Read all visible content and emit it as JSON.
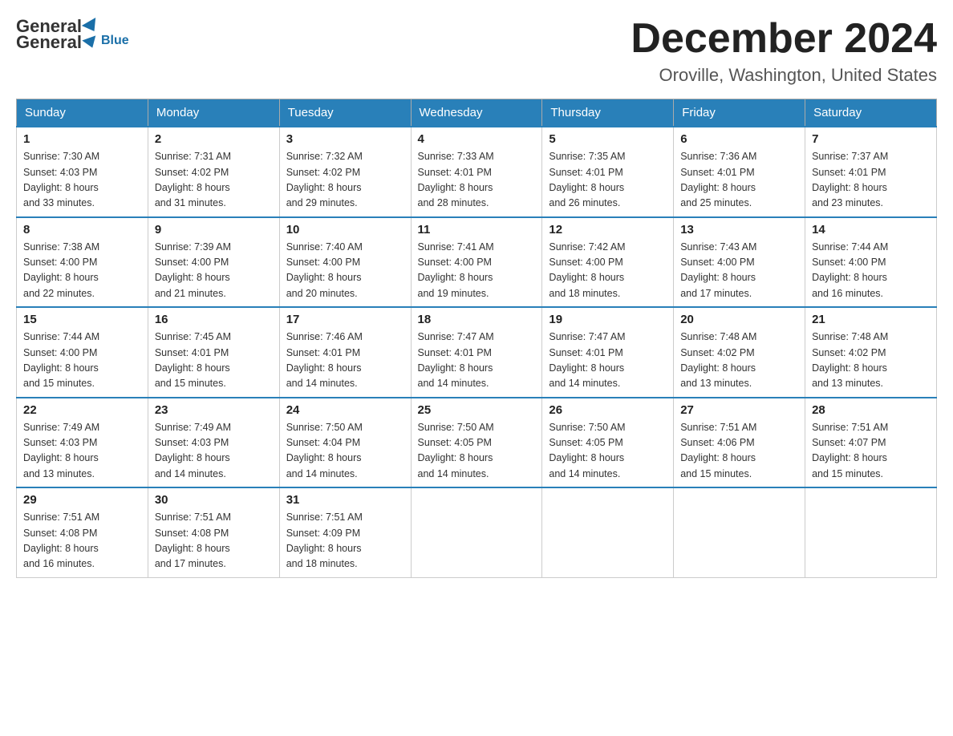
{
  "header": {
    "logo_general": "General",
    "logo_blue": "Blue",
    "month_title": "December 2024",
    "location": "Oroville, Washington, United States"
  },
  "weekdays": [
    "Sunday",
    "Monday",
    "Tuesday",
    "Wednesday",
    "Thursday",
    "Friday",
    "Saturday"
  ],
  "weeks": [
    [
      {
        "day": "1",
        "sunrise": "7:30 AM",
        "sunset": "4:03 PM",
        "daylight": "8 hours and 33 minutes."
      },
      {
        "day": "2",
        "sunrise": "7:31 AM",
        "sunset": "4:02 PM",
        "daylight": "8 hours and 31 minutes."
      },
      {
        "day": "3",
        "sunrise": "7:32 AM",
        "sunset": "4:02 PM",
        "daylight": "8 hours and 29 minutes."
      },
      {
        "day": "4",
        "sunrise": "7:33 AM",
        "sunset": "4:01 PM",
        "daylight": "8 hours and 28 minutes."
      },
      {
        "day": "5",
        "sunrise": "7:35 AM",
        "sunset": "4:01 PM",
        "daylight": "8 hours and 26 minutes."
      },
      {
        "day": "6",
        "sunrise": "7:36 AM",
        "sunset": "4:01 PM",
        "daylight": "8 hours and 25 minutes."
      },
      {
        "day": "7",
        "sunrise": "7:37 AM",
        "sunset": "4:01 PM",
        "daylight": "8 hours and 23 minutes."
      }
    ],
    [
      {
        "day": "8",
        "sunrise": "7:38 AM",
        "sunset": "4:00 PM",
        "daylight": "8 hours and 22 minutes."
      },
      {
        "day": "9",
        "sunrise": "7:39 AM",
        "sunset": "4:00 PM",
        "daylight": "8 hours and 21 minutes."
      },
      {
        "day": "10",
        "sunrise": "7:40 AM",
        "sunset": "4:00 PM",
        "daylight": "8 hours and 20 minutes."
      },
      {
        "day": "11",
        "sunrise": "7:41 AM",
        "sunset": "4:00 PM",
        "daylight": "8 hours and 19 minutes."
      },
      {
        "day": "12",
        "sunrise": "7:42 AM",
        "sunset": "4:00 PM",
        "daylight": "8 hours and 18 minutes."
      },
      {
        "day": "13",
        "sunrise": "7:43 AM",
        "sunset": "4:00 PM",
        "daylight": "8 hours and 17 minutes."
      },
      {
        "day": "14",
        "sunrise": "7:44 AM",
        "sunset": "4:00 PM",
        "daylight": "8 hours and 16 minutes."
      }
    ],
    [
      {
        "day": "15",
        "sunrise": "7:44 AM",
        "sunset": "4:00 PM",
        "daylight": "8 hours and 15 minutes."
      },
      {
        "day": "16",
        "sunrise": "7:45 AM",
        "sunset": "4:01 PM",
        "daylight": "8 hours and 15 minutes."
      },
      {
        "day": "17",
        "sunrise": "7:46 AM",
        "sunset": "4:01 PM",
        "daylight": "8 hours and 14 minutes."
      },
      {
        "day": "18",
        "sunrise": "7:47 AM",
        "sunset": "4:01 PM",
        "daylight": "8 hours and 14 minutes."
      },
      {
        "day": "19",
        "sunrise": "7:47 AM",
        "sunset": "4:01 PM",
        "daylight": "8 hours and 14 minutes."
      },
      {
        "day": "20",
        "sunrise": "7:48 AM",
        "sunset": "4:02 PM",
        "daylight": "8 hours and 13 minutes."
      },
      {
        "day": "21",
        "sunrise": "7:48 AM",
        "sunset": "4:02 PM",
        "daylight": "8 hours and 13 minutes."
      }
    ],
    [
      {
        "day": "22",
        "sunrise": "7:49 AM",
        "sunset": "4:03 PM",
        "daylight": "8 hours and 13 minutes."
      },
      {
        "day": "23",
        "sunrise": "7:49 AM",
        "sunset": "4:03 PM",
        "daylight": "8 hours and 14 minutes."
      },
      {
        "day": "24",
        "sunrise": "7:50 AM",
        "sunset": "4:04 PM",
        "daylight": "8 hours and 14 minutes."
      },
      {
        "day": "25",
        "sunrise": "7:50 AM",
        "sunset": "4:05 PM",
        "daylight": "8 hours and 14 minutes."
      },
      {
        "day": "26",
        "sunrise": "7:50 AM",
        "sunset": "4:05 PM",
        "daylight": "8 hours and 14 minutes."
      },
      {
        "day": "27",
        "sunrise": "7:51 AM",
        "sunset": "4:06 PM",
        "daylight": "8 hours and 15 minutes."
      },
      {
        "day": "28",
        "sunrise": "7:51 AM",
        "sunset": "4:07 PM",
        "daylight": "8 hours and 15 minutes."
      }
    ],
    [
      {
        "day": "29",
        "sunrise": "7:51 AM",
        "sunset": "4:08 PM",
        "daylight": "8 hours and 16 minutes."
      },
      {
        "day": "30",
        "sunrise": "7:51 AM",
        "sunset": "4:08 PM",
        "daylight": "8 hours and 17 minutes."
      },
      {
        "day": "31",
        "sunrise": "7:51 AM",
        "sunset": "4:09 PM",
        "daylight": "8 hours and 18 minutes."
      },
      null,
      null,
      null,
      null
    ]
  ],
  "labels": {
    "sunrise": "Sunrise:",
    "sunset": "Sunset:",
    "daylight": "Daylight:"
  }
}
